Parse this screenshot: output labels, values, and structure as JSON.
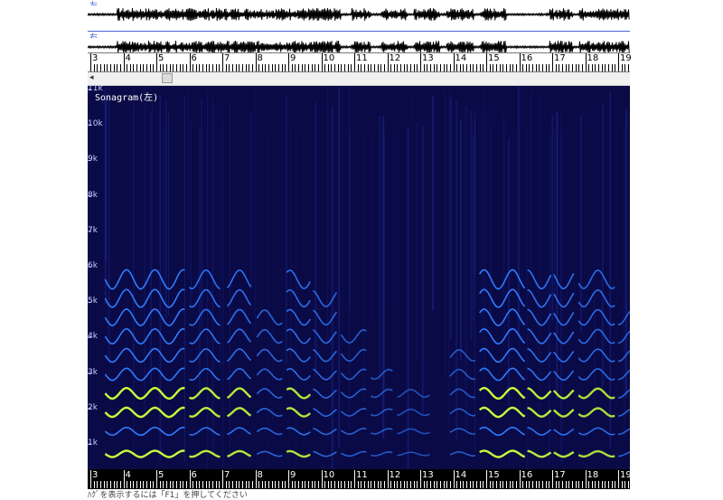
{
  "channels": {
    "left": "左",
    "right": "右"
  },
  "ruler": {
    "labels": [
      "3",
      "4",
      "5",
      "6",
      "7",
      "8",
      "9",
      "10",
      "11",
      "12",
      "13",
      "14",
      "15",
      "16",
      "17",
      "18",
      "19"
    ]
  },
  "scrollbar": {
    "left_arrow": "◂"
  },
  "spectrogram": {
    "title": "Sonagram(左)",
    "freq_labels": [
      "11k",
      "10k",
      "9k",
      "8k",
      "7k",
      "6k",
      "5k",
      "4k",
      "3k",
      "2k",
      "1k"
    ]
  },
  "status": {
    "text": "ﾊｸﾞを表示するには「F1」を押してください"
  },
  "colors": {
    "background": "#0a0a46",
    "harmonic": "#2f7cff",
    "bright": "#c6ff3a",
    "channel_line": "#4b62d9"
  }
}
